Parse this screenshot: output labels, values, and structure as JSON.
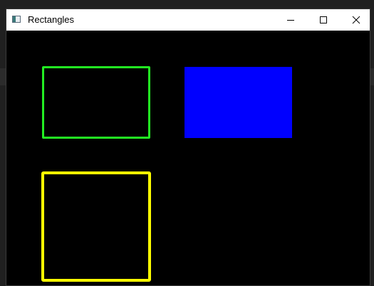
{
  "window": {
    "title": "Rectangles",
    "controls": {
      "minimize_icon": "minimize-icon",
      "maximize_icon": "maximize-icon",
      "close_icon": "close-icon"
    }
  },
  "canvas": {
    "background": "#000000",
    "shapes": [
      {
        "kind": "rectangle-outline",
        "color": "#22ee22"
      },
      {
        "kind": "rectangle-filled",
        "color": "#0000ff"
      },
      {
        "kind": "rectangle-outline",
        "color": "#ffff00"
      }
    ]
  },
  "colors": {
    "titlebar": "#ffffff",
    "green": "#22ee22",
    "blue": "#0000ff",
    "yellow": "#ffff00"
  }
}
